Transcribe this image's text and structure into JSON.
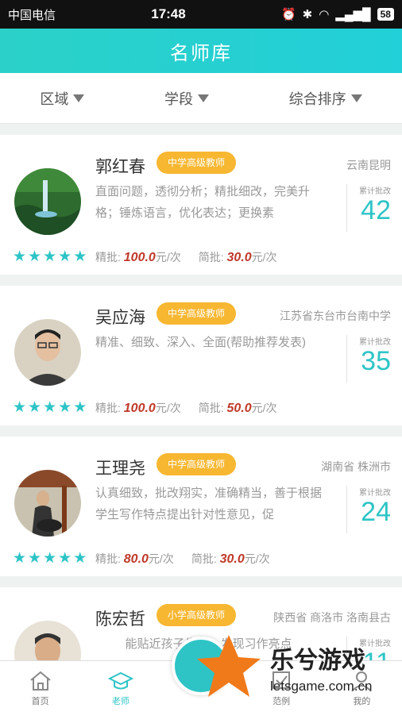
{
  "status": {
    "carrier": "中国电信",
    "time": "17:48",
    "battery": "58"
  },
  "header": {
    "title": "名师库"
  },
  "filters": [
    {
      "label": "区域"
    },
    {
      "label": "学段"
    },
    {
      "label": "综合排序"
    }
  ],
  "teachers": [
    {
      "name": "郭红春",
      "badge": "中学高级教师",
      "location": "云南昆明",
      "desc": "直面问题，透彻分析；精批细改，完美升格；锤炼语言，优化表达；更换素",
      "count_label": "累计批改",
      "count": "42",
      "fine_label": "精批:",
      "fine_price": "100.0",
      "unit": "元/次",
      "simple_label": "简批:",
      "simple_price": "30.0",
      "rating": 5
    },
    {
      "name": "吴应海",
      "badge": "中学高级教师",
      "location": "江苏省东台市台南中学",
      "desc": "精准、细致、深入、全面(帮助推荐发表)",
      "count_label": "累计批改",
      "count": "35",
      "fine_label": "精批:",
      "fine_price": "100.0",
      "unit": "元/次",
      "simple_label": "简批:",
      "simple_price": "50.0",
      "rating": 5
    },
    {
      "name": "王理尧",
      "badge": "中学高级教师",
      "location": "湖南省 株洲市",
      "desc": "认真细致，批改翔实，准确精当，善于根据学生写作特点提出针对性意见，促",
      "count_label": "累计批改",
      "count": "24",
      "fine_label": "精批:",
      "fine_price": "80.0",
      "unit": "元/次",
      "simple_label": "简批:",
      "simple_price": "30.0",
      "rating": 5
    },
    {
      "name": "陈宏哲",
      "badge": "小学高级教师",
      "location": "陕西省 商洛市 洛南县古",
      "desc": "能贴近孩子生活，发现习作亮点",
      "count_label": "累计批改",
      "count": "11"
    }
  ],
  "tabs": [
    {
      "label": "首页"
    },
    {
      "label": "老师"
    },
    {
      "label": "范例"
    },
    {
      "label": "我的"
    }
  ],
  "watermark": {
    "brand": "乐兮游戏",
    "url": "letsgame.com.cn"
  },
  "colors": {
    "accent": "#2ec4c6",
    "badge": "#f7b731",
    "price": "#c0392b"
  }
}
